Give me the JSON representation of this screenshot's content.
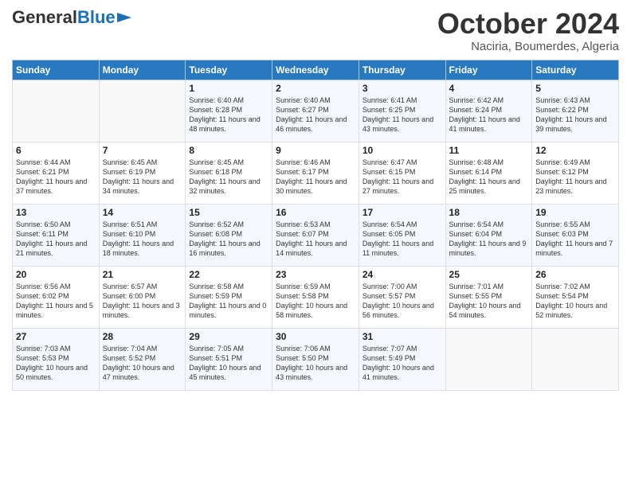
{
  "header": {
    "logo_general": "General",
    "logo_blue": "Blue",
    "title": "October 2024",
    "location": "Naciria, Boumerdes, Algeria"
  },
  "columns": [
    "Sunday",
    "Monday",
    "Tuesday",
    "Wednesday",
    "Thursday",
    "Friday",
    "Saturday"
  ],
  "weeks": [
    [
      {
        "day": "",
        "sunrise": "",
        "sunset": "",
        "daylight": ""
      },
      {
        "day": "",
        "sunrise": "",
        "sunset": "",
        "daylight": ""
      },
      {
        "day": "1",
        "sunrise": "Sunrise: 6:40 AM",
        "sunset": "Sunset: 6:28 PM",
        "daylight": "Daylight: 11 hours and 48 minutes."
      },
      {
        "day": "2",
        "sunrise": "Sunrise: 6:40 AM",
        "sunset": "Sunset: 6:27 PM",
        "daylight": "Daylight: 11 hours and 46 minutes."
      },
      {
        "day": "3",
        "sunrise": "Sunrise: 6:41 AM",
        "sunset": "Sunset: 6:25 PM",
        "daylight": "Daylight: 11 hours and 43 minutes."
      },
      {
        "day": "4",
        "sunrise": "Sunrise: 6:42 AM",
        "sunset": "Sunset: 6:24 PM",
        "daylight": "Daylight: 11 hours and 41 minutes."
      },
      {
        "day": "5",
        "sunrise": "Sunrise: 6:43 AM",
        "sunset": "Sunset: 6:22 PM",
        "daylight": "Daylight: 11 hours and 39 minutes."
      }
    ],
    [
      {
        "day": "6",
        "sunrise": "Sunrise: 6:44 AM",
        "sunset": "Sunset: 6:21 PM",
        "daylight": "Daylight: 11 hours and 37 minutes."
      },
      {
        "day": "7",
        "sunrise": "Sunrise: 6:45 AM",
        "sunset": "Sunset: 6:19 PM",
        "daylight": "Daylight: 11 hours and 34 minutes."
      },
      {
        "day": "8",
        "sunrise": "Sunrise: 6:45 AM",
        "sunset": "Sunset: 6:18 PM",
        "daylight": "Daylight: 11 hours and 32 minutes."
      },
      {
        "day": "9",
        "sunrise": "Sunrise: 6:46 AM",
        "sunset": "Sunset: 6:17 PM",
        "daylight": "Daylight: 11 hours and 30 minutes."
      },
      {
        "day": "10",
        "sunrise": "Sunrise: 6:47 AM",
        "sunset": "Sunset: 6:15 PM",
        "daylight": "Daylight: 11 hours and 27 minutes."
      },
      {
        "day": "11",
        "sunrise": "Sunrise: 6:48 AM",
        "sunset": "Sunset: 6:14 PM",
        "daylight": "Daylight: 11 hours and 25 minutes."
      },
      {
        "day": "12",
        "sunrise": "Sunrise: 6:49 AM",
        "sunset": "Sunset: 6:12 PM",
        "daylight": "Daylight: 11 hours and 23 minutes."
      }
    ],
    [
      {
        "day": "13",
        "sunrise": "Sunrise: 6:50 AM",
        "sunset": "Sunset: 6:11 PM",
        "daylight": "Daylight: 11 hours and 21 minutes."
      },
      {
        "day": "14",
        "sunrise": "Sunrise: 6:51 AM",
        "sunset": "Sunset: 6:10 PM",
        "daylight": "Daylight: 11 hours and 18 minutes."
      },
      {
        "day": "15",
        "sunrise": "Sunrise: 6:52 AM",
        "sunset": "Sunset: 6:08 PM",
        "daylight": "Daylight: 11 hours and 16 minutes."
      },
      {
        "day": "16",
        "sunrise": "Sunrise: 6:53 AM",
        "sunset": "Sunset: 6:07 PM",
        "daylight": "Daylight: 11 hours and 14 minutes."
      },
      {
        "day": "17",
        "sunrise": "Sunrise: 6:54 AM",
        "sunset": "Sunset: 6:05 PM",
        "daylight": "Daylight: 11 hours and 11 minutes."
      },
      {
        "day": "18",
        "sunrise": "Sunrise: 6:54 AM",
        "sunset": "Sunset: 6:04 PM",
        "daylight": "Daylight: 11 hours and 9 minutes."
      },
      {
        "day": "19",
        "sunrise": "Sunrise: 6:55 AM",
        "sunset": "Sunset: 6:03 PM",
        "daylight": "Daylight: 11 hours and 7 minutes."
      }
    ],
    [
      {
        "day": "20",
        "sunrise": "Sunrise: 6:56 AM",
        "sunset": "Sunset: 6:02 PM",
        "daylight": "Daylight: 11 hours and 5 minutes."
      },
      {
        "day": "21",
        "sunrise": "Sunrise: 6:57 AM",
        "sunset": "Sunset: 6:00 PM",
        "daylight": "Daylight: 11 hours and 3 minutes."
      },
      {
        "day": "22",
        "sunrise": "Sunrise: 6:58 AM",
        "sunset": "Sunset: 5:59 PM",
        "daylight": "Daylight: 11 hours and 0 minutes."
      },
      {
        "day": "23",
        "sunrise": "Sunrise: 6:59 AM",
        "sunset": "Sunset: 5:58 PM",
        "daylight": "Daylight: 10 hours and 58 minutes."
      },
      {
        "day": "24",
        "sunrise": "Sunrise: 7:00 AM",
        "sunset": "Sunset: 5:57 PM",
        "daylight": "Daylight: 10 hours and 56 minutes."
      },
      {
        "day": "25",
        "sunrise": "Sunrise: 7:01 AM",
        "sunset": "Sunset: 5:55 PM",
        "daylight": "Daylight: 10 hours and 54 minutes."
      },
      {
        "day": "26",
        "sunrise": "Sunrise: 7:02 AM",
        "sunset": "Sunset: 5:54 PM",
        "daylight": "Daylight: 10 hours and 52 minutes."
      }
    ],
    [
      {
        "day": "27",
        "sunrise": "Sunrise: 7:03 AM",
        "sunset": "Sunset: 5:53 PM",
        "daylight": "Daylight: 10 hours and 50 minutes."
      },
      {
        "day": "28",
        "sunrise": "Sunrise: 7:04 AM",
        "sunset": "Sunset: 5:52 PM",
        "daylight": "Daylight: 10 hours and 47 minutes."
      },
      {
        "day": "29",
        "sunrise": "Sunrise: 7:05 AM",
        "sunset": "Sunset: 5:51 PM",
        "daylight": "Daylight: 10 hours and 45 minutes."
      },
      {
        "day": "30",
        "sunrise": "Sunrise: 7:06 AM",
        "sunset": "Sunset: 5:50 PM",
        "daylight": "Daylight: 10 hours and 43 minutes."
      },
      {
        "day": "31",
        "sunrise": "Sunrise: 7:07 AM",
        "sunset": "Sunset: 5:49 PM",
        "daylight": "Daylight: 10 hours and 41 minutes."
      },
      {
        "day": "",
        "sunrise": "",
        "sunset": "",
        "daylight": ""
      },
      {
        "day": "",
        "sunrise": "",
        "sunset": "",
        "daylight": ""
      }
    ]
  ]
}
